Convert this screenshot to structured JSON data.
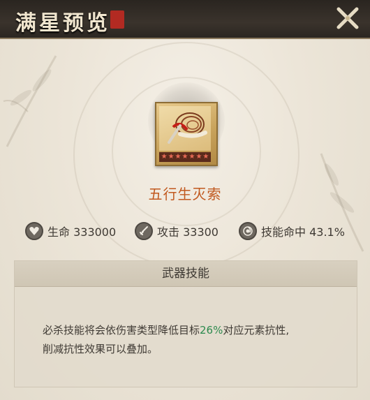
{
  "header": {
    "title": "满星预览",
    "close_icon": "close-x-icon"
  },
  "item": {
    "name": "五行生灭索",
    "stars": 7,
    "icon": "whip-rope-icon"
  },
  "stats": [
    {
      "icon": "heart-icon",
      "label": "生命",
      "value": "333000",
      "text": "生命 333000"
    },
    {
      "icon": "sword-icon",
      "label": "攻击",
      "value": "33300",
      "text": "攻击 33300"
    },
    {
      "icon": "swirl-icon",
      "label": "技能命中",
      "value": "43.1%",
      "text": "技能命中 43.1%"
    }
  ],
  "skill": {
    "title": "武器技能",
    "line1_before": "必杀技能将会依伤害类型降低目标",
    "line1_highlight": "26%",
    "line1_after": "对应元素抗性,",
    "line2": "削减抗性效果可以叠加。"
  },
  "colors": {
    "highlight": "#2d8a4e",
    "item_name": "#c1591f",
    "header": "#2a2520"
  }
}
